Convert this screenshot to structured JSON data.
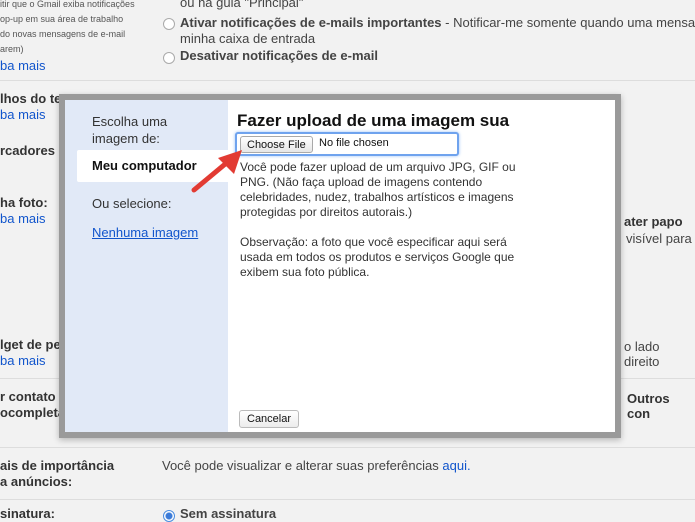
{
  "background": {
    "notif_small": [
      "itir que o Gmail exiba notificações",
      "op-up em sua área de trabalho",
      "do novas mensagens de e-mail",
      "arem)"
    ],
    "learn_more": "ba mais",
    "opt_principal": "ou na guia \"Principal\"",
    "opt_important_bold": "Ativar notificações de e-mails importantes",
    "opt_important_rest": " - Notificar-me somente quando uma mensag",
    "opt_important_line2": "minha caixa de entrada",
    "opt_disable_bold": "Desativar notificações de e-mail",
    "labels": {
      "shortcuts": "lhos do te",
      "markers": "rcadores d",
      "photo": "ha foto:",
      "widget": "lget de pe",
      "contacts1": "r contato",
      "contacts2": "ocompleta",
      "importance1": "ais de importância",
      "importance2": "a anúncios:",
      "signature": "sinatura:"
    },
    "right_chat": "ater papo",
    "right_visible": "visível para",
    "right_side": "o lado direito",
    "right_others": "Outros con",
    "prefs_text": "Você pode visualizar e alterar suas preferências",
    "prefs_link": "aqui.",
    "no_signature": "Sem assinatura"
  },
  "dialog": {
    "side_heading_1": "Escolha uma",
    "side_heading_2": "imagem de:",
    "tab_computer": "Meu computador",
    "or_select": "Ou selecione:",
    "no_image_link": "Nenhuma imagem",
    "title": "Fazer upload de uma imagem sua",
    "choose_file": "Choose File",
    "no_file": "No file chosen",
    "para1": [
      "Você pode fazer upload de um arquivo JPG, GIF ou",
      "PNG. (Não faça upload de imagens contendo",
      "celebridades, nudez, trabalhos artísticos e imagens",
      "protegidas por direitos autorais.)"
    ],
    "para2": [
      "Observação: a foto que você especificar aqui será",
      "usada em todos os produtos e serviços Google que",
      "exibem sua foto pública."
    ],
    "cancel": "Cancelar"
  },
  "colors": {
    "arrow": "#e23b33",
    "link": "#1155cc",
    "side_panel": "#e1e9f7"
  },
  "icons": {
    "arrow": "red-arrow-icon",
    "radio": "radio-icon"
  }
}
